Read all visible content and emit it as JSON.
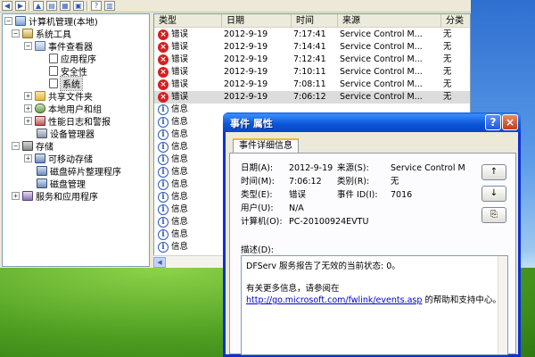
{
  "tree": {
    "root": "计算机管理(本地)",
    "items": [
      {
        "label": "系统工具",
        "expander": "−"
      },
      {
        "label": "事件查看器",
        "expander": "−"
      },
      {
        "label": "应用程序",
        "expander": ""
      },
      {
        "label": "安全性",
        "expander": ""
      },
      {
        "label": "系统",
        "expander": ""
      },
      {
        "label": "共享文件夹",
        "expander": "+"
      },
      {
        "label": "本地用户和组",
        "expander": "+"
      },
      {
        "label": "性能日志和警报",
        "expander": "+"
      },
      {
        "label": "设备管理器",
        "expander": ""
      },
      {
        "label": "存储",
        "expander": "−"
      },
      {
        "label": "可移动存储",
        "expander": "+"
      },
      {
        "label": "磁盘碎片整理程序",
        "expander": ""
      },
      {
        "label": "磁盘管理",
        "expander": ""
      },
      {
        "label": "服务和应用程序",
        "expander": "+"
      }
    ],
    "root_expander": "−"
  },
  "list": {
    "columns": [
      "类型",
      "日期",
      "时间",
      "来源",
      "分类"
    ],
    "rows": [
      {
        "type": "错误",
        "date": "2012-9-19",
        "time": "7:17:41",
        "source": "Service Control M...",
        "category": "无",
        "level": "error"
      },
      {
        "type": "错误",
        "date": "2012-9-19",
        "time": "7:14:41",
        "source": "Service Control M...",
        "category": "无",
        "level": "error"
      },
      {
        "type": "错误",
        "date": "2012-9-19",
        "time": "7:12:41",
        "source": "Service Control M...",
        "category": "无",
        "level": "error"
      },
      {
        "type": "错误",
        "date": "2012-9-19",
        "time": "7:10:11",
        "source": "Service Control M...",
        "category": "无",
        "level": "error"
      },
      {
        "type": "错误",
        "date": "2012-9-19",
        "time": "7:08:11",
        "source": "Service Control M...",
        "category": "无",
        "level": "error"
      },
      {
        "type": "错误",
        "date": "2012-9-19",
        "time": "7:06:12",
        "source": "Service Control M...",
        "category": "无",
        "level": "error"
      },
      {
        "type": "信息",
        "date": "",
        "time": "",
        "source": "",
        "category": "",
        "level": "info"
      },
      {
        "type": "信息",
        "date": "",
        "time": "",
        "source": "",
        "category": "",
        "level": "info"
      },
      {
        "type": "信息",
        "date": "",
        "time": "",
        "source": "",
        "category": "",
        "level": "info"
      },
      {
        "type": "信息",
        "date": "",
        "time": "",
        "source": "",
        "category": "",
        "level": "info"
      },
      {
        "type": "信息",
        "date": "",
        "time": "",
        "source": "",
        "category": "",
        "level": "info"
      },
      {
        "type": "信息",
        "date": "",
        "time": "",
        "source": "",
        "category": "",
        "level": "info"
      },
      {
        "type": "信息",
        "date": "",
        "time": "",
        "source": "",
        "category": "",
        "level": "info"
      },
      {
        "type": "信息",
        "date": "",
        "time": "",
        "source": "",
        "category": "",
        "level": "info"
      },
      {
        "type": "信息",
        "date": "",
        "time": "",
        "source": "",
        "category": "",
        "level": "info"
      },
      {
        "type": "信息",
        "date": "",
        "time": "",
        "source": "",
        "category": "",
        "level": "info"
      },
      {
        "type": "信息",
        "date": "",
        "time": "",
        "source": "",
        "category": "",
        "level": "info"
      },
      {
        "type": "信息",
        "date": "",
        "time": "",
        "source": "",
        "category": "",
        "level": "info"
      }
    ]
  },
  "dialog": {
    "title": "事件 属性",
    "tab": "事件详细信息",
    "help_label": "?",
    "close_label": "×",
    "date_label": "日期(A):",
    "date_value": "2012-9-19",
    "source_label": "来源(S):",
    "source_value": "Service Control M",
    "time_label": "时间(M):",
    "time_value": "7:06:12",
    "category_label": "类别(R):",
    "category_value": "无",
    "type_label": "类型(E):",
    "type_value": "错误",
    "event_id_label": "事件 ID(I):",
    "event_id_value": "7016",
    "user_label": "用户(U):",
    "user_value": "N/A",
    "computer_label": "计算机(O):",
    "computer_value": "PC-20100924EVTU",
    "description_label": "描述(D):",
    "description_line1": "DFServ 服务报告了无效的当前状态: 0。",
    "description_line2": "有关更多信息，请参阅在",
    "description_link": "http://go.microsoft.com/fwlink/events.asp",
    "description_line3": " 的帮助和支持中心。",
    "up_label": "↑",
    "down_label": "↓",
    "copy_label": "⎘"
  },
  "colors": {
    "error": "#d42020",
    "info": "#2f5bb5",
    "titlebar": "#0a55d8"
  }
}
